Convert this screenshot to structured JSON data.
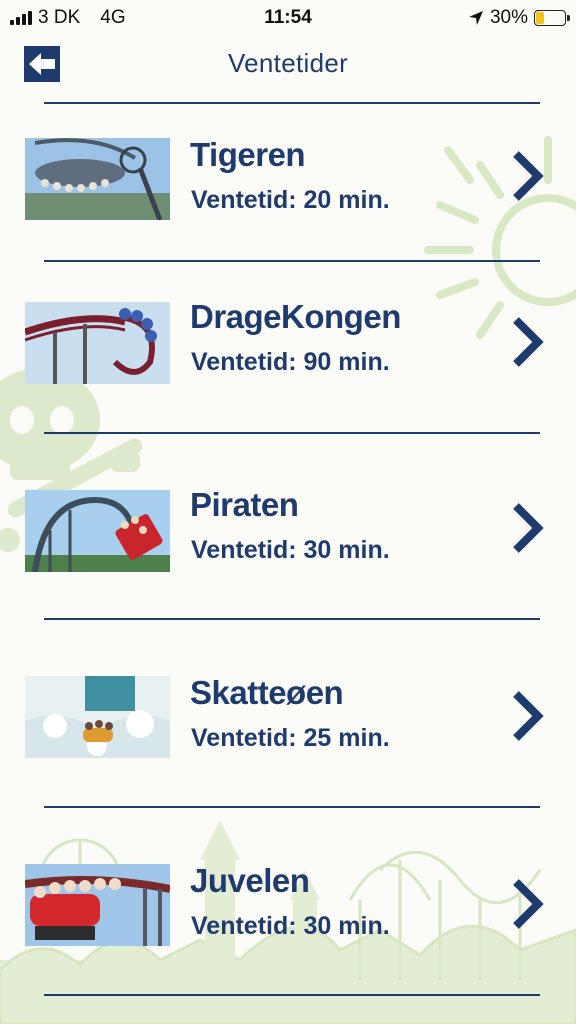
{
  "status_bar": {
    "carrier": "3 DK",
    "network": "4G",
    "time": "11:54",
    "battery_percent": "30%",
    "battery_level": 0.3
  },
  "header": {
    "title": "Ventetider",
    "back_icon": "back-arrow-icon"
  },
  "colors": {
    "primary": "#1f3b6e",
    "decoration": "#d9e8c4",
    "background": "#fbfcf8"
  },
  "rides": [
    {
      "name": "Tigeren",
      "wait": "Ventetid: 20 min."
    },
    {
      "name": "DrageKongen",
      "wait": "Ventetid: 90 min."
    },
    {
      "name": "Piraten",
      "wait": "Ventetid: 30 min."
    },
    {
      "name": "Skatteøen",
      "wait": "Ventetid: 25 min."
    },
    {
      "name": "Juvelen",
      "wait": "Ventetid: 30 min."
    }
  ]
}
